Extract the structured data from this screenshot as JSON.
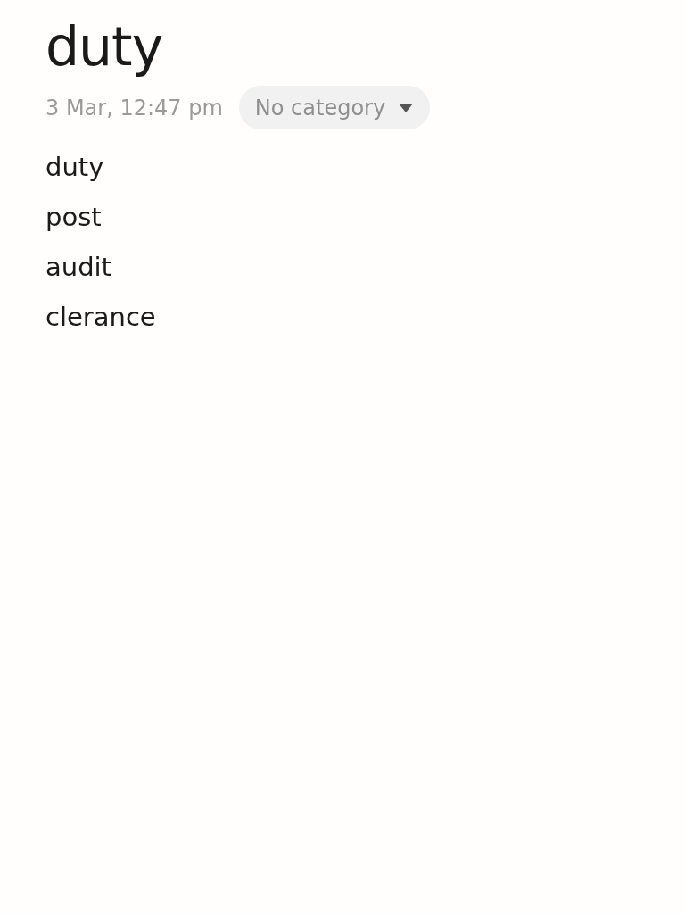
{
  "note": {
    "title": "duty",
    "timestamp": "3 Mar, 12:47 pm",
    "category": {
      "label": "No category"
    },
    "lines": [
      "duty",
      "post",
      "audit",
      "clerance"
    ]
  }
}
